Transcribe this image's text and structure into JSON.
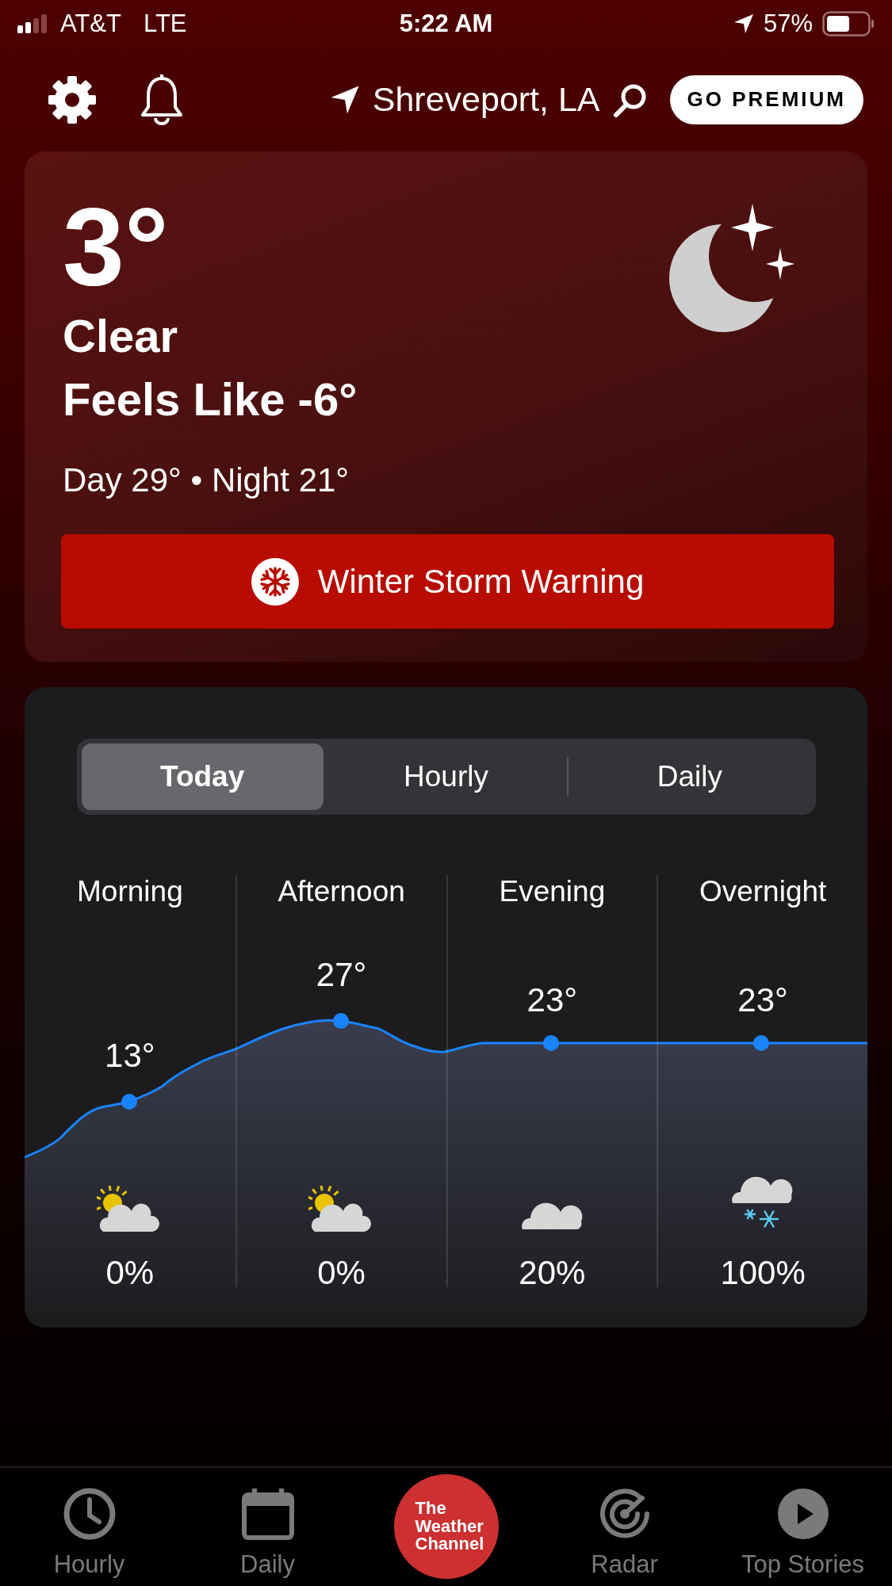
{
  "status_bar": {
    "carrier": "AT&T",
    "network": "LTE",
    "time": "5:22 AM",
    "battery": "57%"
  },
  "header": {
    "location": "Shreveport, LA",
    "premium_button": "GO PREMIUM"
  },
  "current": {
    "temperature": "3°",
    "condition": "Clear",
    "feels_like": "Feels Like -6°",
    "day_night": "Day 29° • Night 21°",
    "alert": "Winter Storm Warning"
  },
  "forecast": {
    "tabs": [
      {
        "label": "Today",
        "selected": true
      },
      {
        "label": "Hourly",
        "selected": false
      },
      {
        "label": "Daily",
        "selected": false
      }
    ],
    "periods": [
      {
        "label": "Morning",
        "temperature": "13°",
        "precipitation": "0%",
        "kind": "partly-sunny"
      },
      {
        "label": "Afternoon",
        "temperature": "27°",
        "precipitation": "0%",
        "kind": "partly-sunny"
      },
      {
        "label": "Evening",
        "temperature": "23°",
        "precipitation": "20%",
        "kind": "cloudy"
      },
      {
        "label": "Overnight",
        "temperature": "23°",
        "precipitation": "100%",
        "kind": "snow"
      }
    ]
  },
  "bottom_nav": [
    {
      "label": "Hourly",
      "kind": "clock"
    },
    {
      "label": "Daily",
      "kind": "calendar"
    },
    {
      "label": "The Weather Channel",
      "kind": "logo"
    },
    {
      "label": "Radar",
      "kind": "radar"
    },
    {
      "label": "Top Stories",
      "kind": "play"
    }
  ]
}
